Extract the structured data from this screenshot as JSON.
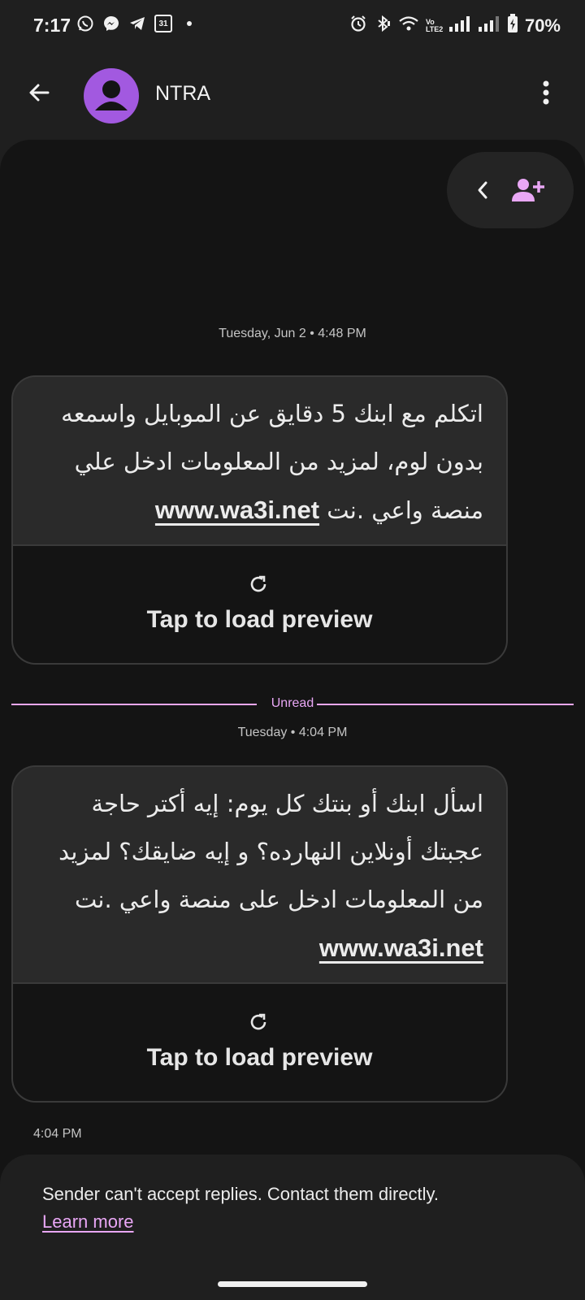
{
  "status_bar": {
    "time": "7:17",
    "left_icons": [
      "whatsapp-icon",
      "messenger-icon",
      "telegram-icon",
      "calendar-icon",
      "dot-icon"
    ],
    "calendar_day": "31",
    "right_icons": [
      "alarm-icon",
      "bluetooth-icon",
      "wifi-icon",
      "volte-icon",
      "signal-icon",
      "signal-icon",
      "battery-icon"
    ],
    "volte_label": "Vo LTE2",
    "battery": "70%"
  },
  "app_bar": {
    "contact_name": "NTRA"
  },
  "conversation": {
    "messages": [
      {
        "timestamp": "Tuesday, Jun 2 • 4:48 PM",
        "text": "اتكلم مع ابنك 5 دقايق عن الموبايل واسمعه بدون لوم، لمزيد من المعلومات ادخل علي منصة واعي .نت",
        "link": "www.wa3i.net",
        "preview_label": "Tap to load preview"
      },
      {
        "timestamp": "Tuesday • 4:04 PM",
        "text": "اسأل ابنك أو بنتك كل يوم: إيه أكتر حاجة عجبتك أونلاين النهارده؟ و إيه ضايقك؟ لمزيد من المعلومات ادخل على منصة واعي .نت",
        "link": "www.wa3i.net",
        "preview_label": "Tap to load preview",
        "sent_time": "4:04 PM"
      }
    ],
    "unread_label": "Unread"
  },
  "footer": {
    "notice": "Sender can't accept replies. Contact them directly.",
    "learn_more": "Learn more"
  },
  "colors": {
    "accent": "#e9a7f5",
    "avatar": "#a259e0",
    "background": "#141414",
    "bubble": "#2a2a2a"
  }
}
